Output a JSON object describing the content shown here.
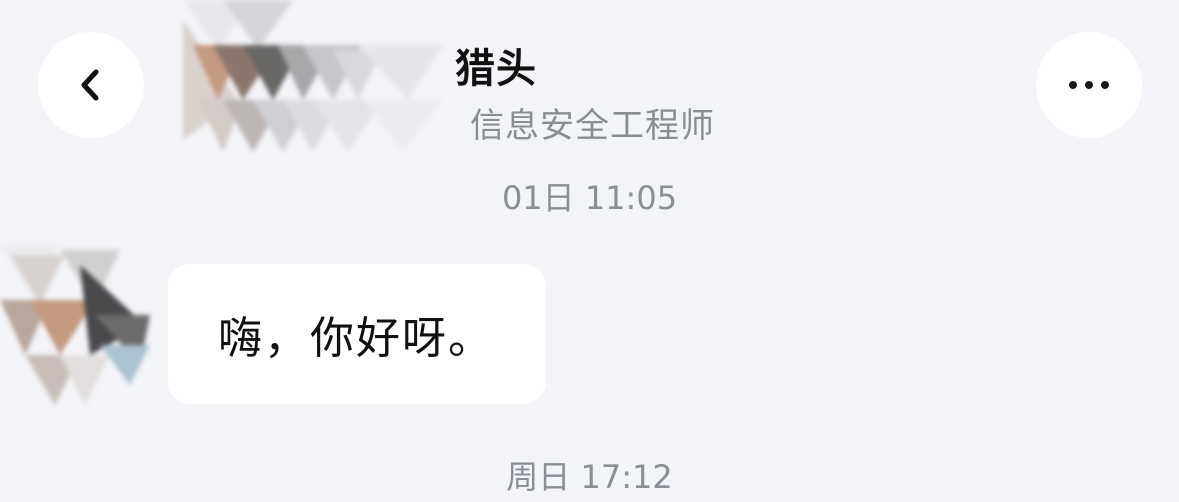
{
  "header": {
    "contact_name": "猎头",
    "contact_title": "信息安全工程师",
    "back_icon": "chevron-left-icon",
    "more_icon": "more-horizontal-icon"
  },
  "messages": [
    {
      "timestamp": "01日 11:05",
      "text": "嗨，你好呀。",
      "sender": "contact"
    }
  ],
  "next_timestamp": "周日 17:12",
  "colors": {
    "background": "#f3f4f8",
    "bubble": "#ffffff",
    "timestamp": "#8b8e96",
    "title": "#8a8d94"
  }
}
